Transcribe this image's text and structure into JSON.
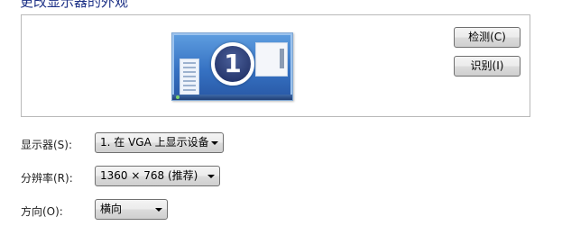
{
  "page": {
    "title": "更改显示器的外观"
  },
  "preview": {
    "monitor_number": "1"
  },
  "buttons": {
    "detect": "检测(C)",
    "identify": "识别(I)"
  },
  "fields": {
    "display": {
      "label": "显示器(S):",
      "value": "1. 在 VGA 上显示设备"
    },
    "resolution": {
      "label": "分辨率(R):",
      "value": "1360 × 768 (推荐)"
    },
    "orientation": {
      "label": "方向(O):",
      "value": "横向"
    }
  }
}
